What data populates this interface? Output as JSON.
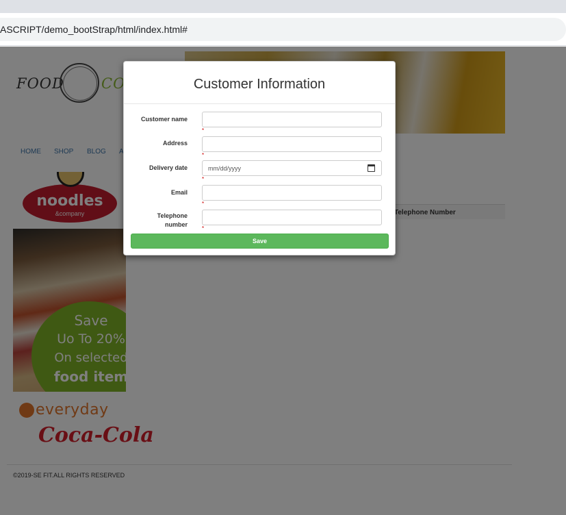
{
  "browser": {
    "url": "ASCRIPT/demo_bootStrap/html/index.html#"
  },
  "page": {
    "logo": {
      "word_left": "FOOD",
      "word_right": "CO"
    },
    "nav": [
      "HOME",
      "SHOP",
      "BLOG",
      "A"
    ],
    "ads": {
      "noodles": {
        "title": "noodles",
        "subtitle": "&company"
      },
      "promo": [
        "Save",
        "Uo To 20%",
        "On selected",
        "food item"
      ],
      "everyday": "everyday",
      "cocacola": "Coca-Cola"
    },
    "table": {
      "visible_header": "Telephone Number"
    },
    "footer": "©2019-SE FIT.ALL RIGHTS RESERVED"
  },
  "modal": {
    "title": "Customer Information",
    "fields": [
      {
        "label": "Customer name",
        "value": "",
        "required_mark": "*"
      },
      {
        "label": "Address",
        "value": "",
        "required_mark": "*"
      },
      {
        "label": "Delivery date",
        "placeholder": "mm/dd/yyyy",
        "required_mark": "*"
      },
      {
        "label": "Email",
        "value": "",
        "required_mark": "*"
      },
      {
        "label": "Telephone",
        "label_line2": "number",
        "value": "",
        "required_mark": "*"
      }
    ],
    "save_label": "Save"
  },
  "colors": {
    "save_button": "#5cb85c",
    "nav_link": "#3a73a8",
    "required": "#cc0000"
  }
}
